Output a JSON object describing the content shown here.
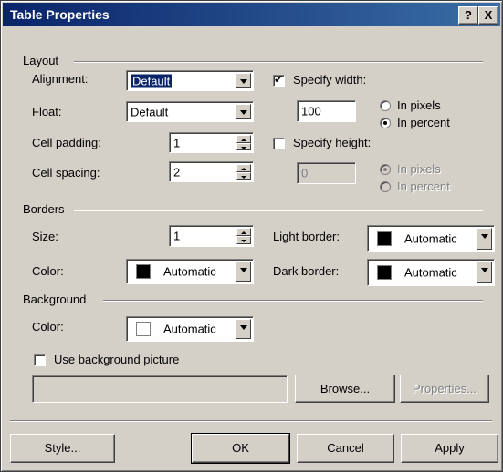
{
  "window": {
    "title": "Table Properties",
    "help_label": "?",
    "close_label": "X"
  },
  "layout": {
    "group_label": "Layout",
    "alignment": {
      "label": "Alignment:",
      "value": "Default"
    },
    "float": {
      "label": "Float:",
      "value": "Default"
    },
    "cell_padding": {
      "label": "Cell padding:",
      "value": "1"
    },
    "cell_spacing": {
      "label": "Cell spacing:",
      "value": "2"
    },
    "specify_width": {
      "label": "Specify width:",
      "checked": true,
      "value": "100",
      "units": [
        {
          "label": "In pixels",
          "selected": false
        },
        {
          "label": "In percent",
          "selected": true
        }
      ]
    },
    "specify_height": {
      "label": "Specify height:",
      "checked": false,
      "value": "0",
      "units": [
        {
          "label": "In pixels",
          "selected": true
        },
        {
          "label": "In percent",
          "selected": false
        }
      ]
    }
  },
  "borders": {
    "group_label": "Borders",
    "size": {
      "label": "Size:",
      "value": "1"
    },
    "color": {
      "label": "Color:",
      "value": "Automatic",
      "swatch": "#000000"
    },
    "light_border": {
      "label": "Light border:",
      "value": "Automatic",
      "swatch": "#000000"
    },
    "dark_border": {
      "label": "Dark border:",
      "value": "Automatic",
      "swatch": "#000000"
    }
  },
  "background": {
    "group_label": "Background",
    "color": {
      "label": "Color:",
      "value": "Automatic",
      "swatch": "#ffffff"
    },
    "use_picture": {
      "label": "Use background picture",
      "checked": false
    },
    "picture_path": "",
    "browse_label": "Browse...",
    "properties_label": "Properties..."
  },
  "buttons": {
    "style": "Style...",
    "ok": "OK",
    "cancel": "Cancel",
    "apply": "Apply"
  }
}
